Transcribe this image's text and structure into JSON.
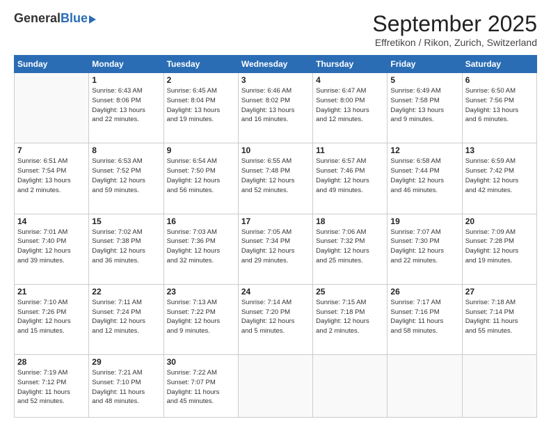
{
  "header": {
    "logo_general": "General",
    "logo_blue": "Blue",
    "title": "September 2025",
    "location": "Effretikon / Rikon, Zurich, Switzerland"
  },
  "days_of_week": [
    "Sunday",
    "Monday",
    "Tuesday",
    "Wednesday",
    "Thursday",
    "Friday",
    "Saturday"
  ],
  "weeks": [
    [
      {
        "day": "",
        "info": ""
      },
      {
        "day": "1",
        "info": "Sunrise: 6:43 AM\nSunset: 8:06 PM\nDaylight: 13 hours\nand 22 minutes."
      },
      {
        "day": "2",
        "info": "Sunrise: 6:45 AM\nSunset: 8:04 PM\nDaylight: 13 hours\nand 19 minutes."
      },
      {
        "day": "3",
        "info": "Sunrise: 6:46 AM\nSunset: 8:02 PM\nDaylight: 13 hours\nand 16 minutes."
      },
      {
        "day": "4",
        "info": "Sunrise: 6:47 AM\nSunset: 8:00 PM\nDaylight: 13 hours\nand 12 minutes."
      },
      {
        "day": "5",
        "info": "Sunrise: 6:49 AM\nSunset: 7:58 PM\nDaylight: 13 hours\nand 9 minutes."
      },
      {
        "day": "6",
        "info": "Sunrise: 6:50 AM\nSunset: 7:56 PM\nDaylight: 13 hours\nand 6 minutes."
      }
    ],
    [
      {
        "day": "7",
        "info": "Sunrise: 6:51 AM\nSunset: 7:54 PM\nDaylight: 13 hours\nand 2 minutes."
      },
      {
        "day": "8",
        "info": "Sunrise: 6:53 AM\nSunset: 7:52 PM\nDaylight: 12 hours\nand 59 minutes."
      },
      {
        "day": "9",
        "info": "Sunrise: 6:54 AM\nSunset: 7:50 PM\nDaylight: 12 hours\nand 56 minutes."
      },
      {
        "day": "10",
        "info": "Sunrise: 6:55 AM\nSunset: 7:48 PM\nDaylight: 12 hours\nand 52 minutes."
      },
      {
        "day": "11",
        "info": "Sunrise: 6:57 AM\nSunset: 7:46 PM\nDaylight: 12 hours\nand 49 minutes."
      },
      {
        "day": "12",
        "info": "Sunrise: 6:58 AM\nSunset: 7:44 PM\nDaylight: 12 hours\nand 46 minutes."
      },
      {
        "day": "13",
        "info": "Sunrise: 6:59 AM\nSunset: 7:42 PM\nDaylight: 12 hours\nand 42 minutes."
      }
    ],
    [
      {
        "day": "14",
        "info": "Sunrise: 7:01 AM\nSunset: 7:40 PM\nDaylight: 12 hours\nand 39 minutes."
      },
      {
        "day": "15",
        "info": "Sunrise: 7:02 AM\nSunset: 7:38 PM\nDaylight: 12 hours\nand 36 minutes."
      },
      {
        "day": "16",
        "info": "Sunrise: 7:03 AM\nSunset: 7:36 PM\nDaylight: 12 hours\nand 32 minutes."
      },
      {
        "day": "17",
        "info": "Sunrise: 7:05 AM\nSunset: 7:34 PM\nDaylight: 12 hours\nand 29 minutes."
      },
      {
        "day": "18",
        "info": "Sunrise: 7:06 AM\nSunset: 7:32 PM\nDaylight: 12 hours\nand 25 minutes."
      },
      {
        "day": "19",
        "info": "Sunrise: 7:07 AM\nSunset: 7:30 PM\nDaylight: 12 hours\nand 22 minutes."
      },
      {
        "day": "20",
        "info": "Sunrise: 7:09 AM\nSunset: 7:28 PM\nDaylight: 12 hours\nand 19 minutes."
      }
    ],
    [
      {
        "day": "21",
        "info": "Sunrise: 7:10 AM\nSunset: 7:26 PM\nDaylight: 12 hours\nand 15 minutes."
      },
      {
        "day": "22",
        "info": "Sunrise: 7:11 AM\nSunset: 7:24 PM\nDaylight: 12 hours\nand 12 minutes."
      },
      {
        "day": "23",
        "info": "Sunrise: 7:13 AM\nSunset: 7:22 PM\nDaylight: 12 hours\nand 9 minutes."
      },
      {
        "day": "24",
        "info": "Sunrise: 7:14 AM\nSunset: 7:20 PM\nDaylight: 12 hours\nand 5 minutes."
      },
      {
        "day": "25",
        "info": "Sunrise: 7:15 AM\nSunset: 7:18 PM\nDaylight: 12 hours\nand 2 minutes."
      },
      {
        "day": "26",
        "info": "Sunrise: 7:17 AM\nSunset: 7:16 PM\nDaylight: 11 hours\nand 58 minutes."
      },
      {
        "day": "27",
        "info": "Sunrise: 7:18 AM\nSunset: 7:14 PM\nDaylight: 11 hours\nand 55 minutes."
      }
    ],
    [
      {
        "day": "28",
        "info": "Sunrise: 7:19 AM\nSunset: 7:12 PM\nDaylight: 11 hours\nand 52 minutes."
      },
      {
        "day": "29",
        "info": "Sunrise: 7:21 AM\nSunset: 7:10 PM\nDaylight: 11 hours\nand 48 minutes."
      },
      {
        "day": "30",
        "info": "Sunrise: 7:22 AM\nSunset: 7:07 PM\nDaylight: 11 hours\nand 45 minutes."
      },
      {
        "day": "",
        "info": ""
      },
      {
        "day": "",
        "info": ""
      },
      {
        "day": "",
        "info": ""
      },
      {
        "day": "",
        "info": ""
      }
    ]
  ]
}
